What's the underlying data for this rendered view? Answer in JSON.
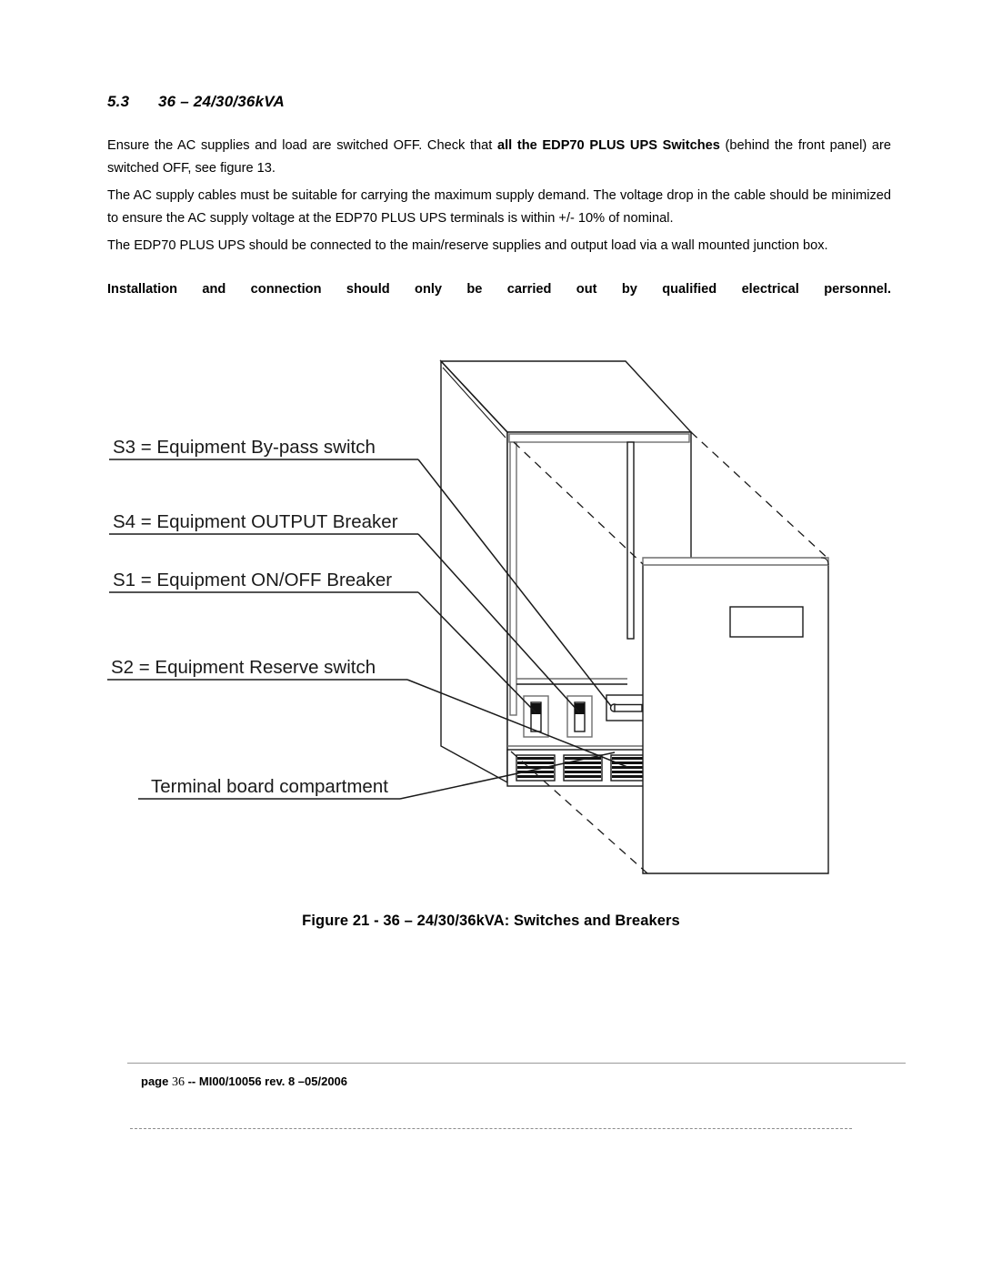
{
  "document": {
    "section_number": "5.3",
    "section_title": "36 – 24/30/36kVA",
    "paragraphs": {
      "p1_a": "Ensure the AC supplies and load are switched OFF. Check that ",
      "p1_bold": "all the EDP70 PLUS UPS Switches",
      "p1_b": " (behind the front panel) are switched OFF, see figure 13.",
      "p2": "The AC supply cables must be suitable for carrying the maximum supply demand. The voltage drop in the cable should be minimized to ensure the AC supply voltage at the EDP70 PLUS UPS terminals is within +/- 10% of nominal.",
      "p3": "The EDP70 PLUS UPS should be connected to the main/reserve supplies and output load via a wall mounted junction box.",
      "warning": "Installation and connection should only be carried out by qualified electrical personnel."
    },
    "figure": {
      "caption": "Figure 21 - 36 – 24/30/36kVA: Switches and Breakers",
      "labels": [
        {
          "id": "s3",
          "text": "S3 = Equipment By-pass switch"
        },
        {
          "id": "s4",
          "text": "S4 = Equipment OUTPUT Breaker"
        },
        {
          "id": "s1",
          "text": "S1 = Equipment ON/OFF Breaker"
        },
        {
          "id": "s2",
          "text": "S2 = Equipment Reserve switch"
        },
        {
          "id": "terminal",
          "text": "Terminal board compartment"
        }
      ]
    },
    "footer": {
      "label": "page",
      "page_number": "36",
      "separator": "--",
      "reference": "MI00/10056 rev. 8 –05/2006"
    }
  },
  "colors": {
    "text": "#000000",
    "line": "#1a1a1a",
    "rule": "#9a9a9a",
    "grey_edge": "#6e6e6e"
  }
}
